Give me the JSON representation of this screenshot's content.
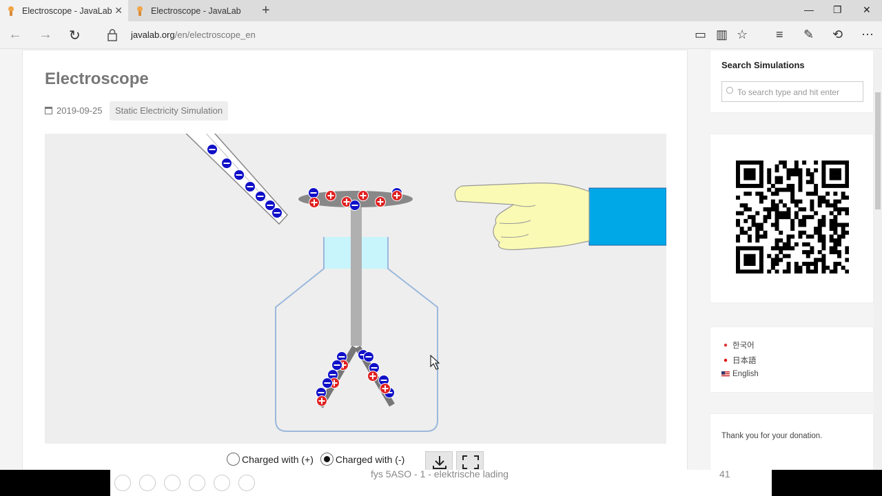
{
  "browser": {
    "tabs": [
      {
        "title": "Electroscope - JavaLab",
        "active": true
      },
      {
        "title": "Electroscope - JavaLab",
        "active": false
      }
    ],
    "new_tab": "+",
    "url_host": "javalab.org",
    "url_path": "/en/electroscope_en",
    "window_controls": {
      "minimize": "—",
      "maximize": "❐",
      "close": "✕"
    },
    "toolbar_icons": [
      "reading-view-icon",
      "book-icon",
      "favorite-star-icon",
      "hub-icon",
      "web-note-icon",
      "share-icon",
      "more-icon"
    ]
  },
  "article": {
    "title": "Electroscope",
    "date": "2019-09-25",
    "category": "Static Electricity Simulation"
  },
  "simulation": {
    "options": [
      {
        "label": "Charged with (+)",
        "selected": false
      },
      {
        "label": "Charged with (-)",
        "selected": true
      }
    ],
    "buttons": [
      "download-icon",
      "fullscreen-icon"
    ]
  },
  "sidebar": {
    "search_title": "Search Simulations",
    "search_placeholder": "To search type and hit enter",
    "languages": [
      {
        "label": "한국어",
        "flag": "kr"
      },
      {
        "label": "日本語",
        "flag": "jp"
      },
      {
        "label": "English",
        "flag": "us"
      }
    ],
    "donation_text": "Thank you for your donation."
  },
  "slideshow": {
    "caption": "fys 5ASO - 1 - elektrische lading",
    "page_number": "41"
  },
  "colors": {
    "negative": "#1010c8",
    "positive": "#e02020",
    "sleeve": "#00a8e8",
    "hand": "#fafab4",
    "jar_border": "#9ab8dc"
  }
}
